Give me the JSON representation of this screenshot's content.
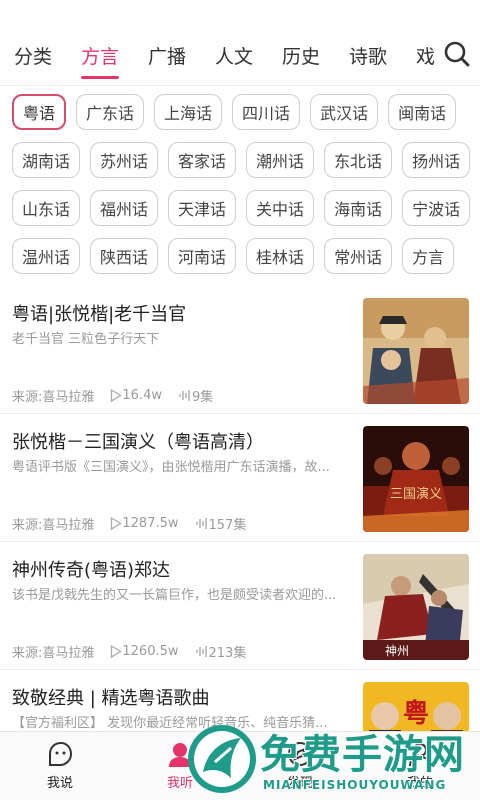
{
  "tabs": [
    {
      "label": "分类",
      "active": false
    },
    {
      "label": "方言",
      "active": true
    },
    {
      "label": "广播",
      "active": false
    },
    {
      "label": "人文",
      "active": false
    },
    {
      "label": "历史",
      "active": false
    },
    {
      "label": "诗歌",
      "active": false
    },
    {
      "label": "戏",
      "active": false
    }
  ],
  "search_icon": "search-icon",
  "chips": [
    [
      "粤语",
      "广东话",
      "上海话",
      "四川话",
      "武汉话",
      "闽南话"
    ],
    [
      "湖南话",
      "苏州话",
      "客家话",
      "潮州话",
      "东北话",
      "扬州话"
    ],
    [
      "山东话",
      "福州话",
      "天津话",
      "关中话",
      "海南话",
      "宁波话"
    ],
    [
      "温州话",
      "陕西话",
      "河南话",
      "桂林话",
      "常州话",
      "方言"
    ]
  ],
  "selected_chip": "粤语",
  "items": [
    {
      "title": "粤语|张悦楷|老千当官",
      "subtitle": "老千当官 三粒色子行天下",
      "source": "来源:喜马拉雅",
      "plays": "16.4w",
      "episodes": "9集"
    },
    {
      "title": "张悦楷－三国演义（粤语高清）",
      "subtitle": "粤语评书版《三国演义》，由张悦楷用广东话演播，故...",
      "source": "来源:喜马拉雅",
      "plays": "1287.5w",
      "episodes": "157集"
    },
    {
      "title": "神州传奇(粤语)郑达",
      "subtitle": "该书是戊戟先生的又一长篇巨作，也是颇受读者欢迎的...",
      "source": "来源:喜马拉雅",
      "plays": "1260.5w",
      "episodes": "213集"
    },
    {
      "title": "致敬经典 | 精选粤语歌曲",
      "subtitle": "【官方福利区】 发现你最近经常听轻音乐、纯音乐猜...",
      "source": "",
      "plays": "",
      "episodes": ""
    }
  ],
  "cover_texts": {
    "c2": "三国演义",
    "c3": "神州",
    "c4": "粤"
  },
  "bottom_nav": [
    {
      "label": "我说",
      "icon": "face-icon",
      "active": false
    },
    {
      "label": "我听",
      "icon": "listen-icon",
      "active": true
    },
    {
      "label": "发现",
      "icon": "discover-icon",
      "active": false
    },
    {
      "label": "我的",
      "icon": "profile-icon",
      "active": false
    }
  ],
  "watermark": {
    "title": "免费手游网",
    "subtitle": "MIANFEISHOUYOUWANG"
  },
  "colors": {
    "accent": "#e4346a",
    "watermark": "#1f9b8a"
  }
}
